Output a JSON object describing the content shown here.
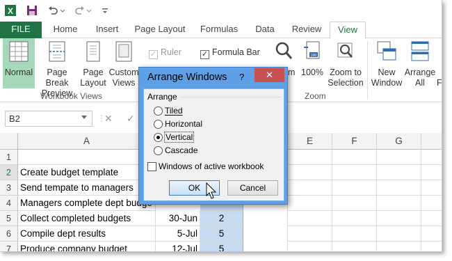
{
  "ribbon_tabs": {
    "file": "FILE",
    "home": "Home",
    "insert": "Insert",
    "page_layout": "Page Layout",
    "formulas": "Formulas",
    "data": "Data",
    "review": "Review",
    "view": "View"
  },
  "ribbon": {
    "normal": "Normal",
    "page_break_1": "Page Break",
    "page_break_2": "Preview",
    "page_layout_1": "Page",
    "page_layout_2": "Layout",
    "custom_1": "Custom",
    "custom_2": "Views",
    "workbook_views": "Workbook Views",
    "ruler": "Ruler",
    "formula_bar": "Formula Bar",
    "zoom_partial": "m",
    "zoom100": "100%",
    "zoom_selection_1": "Zoom to",
    "zoom_selection_2": "Selection",
    "zoom_group": "Zoom",
    "new_window_1": "New",
    "new_window_2": "Window",
    "arrange_all_1": "Arrange",
    "arrange_all_2": "All",
    "overflow": "F"
  },
  "formula_bar": {
    "name_box": "B2",
    "cancel": "✕",
    "enter": "✓"
  },
  "columns": [
    "A",
    "E",
    "F",
    "G"
  ],
  "rows": [
    {
      "num": "1",
      "task": "",
      "date": "",
      "days": ""
    },
    {
      "num": "2",
      "task": "Create budget template",
      "date": "",
      "days": ""
    },
    {
      "num": "3",
      "task": "Send tempate to managers",
      "date": "",
      "days": ""
    },
    {
      "num": "4",
      "task": "Managers complete dept budge",
      "date": "",
      "days": ""
    },
    {
      "num": "5",
      "task": "Collect completed budgets",
      "date": "30-Jun",
      "days": "2"
    },
    {
      "num": "6",
      "task": "Compile dept results",
      "date": "5-Jul",
      "days": "5"
    },
    {
      "num": "7",
      "task": "Produce company budget",
      "date": "12-Jul",
      "days": "5"
    }
  ],
  "dialog": {
    "title": "Arrange Windows",
    "help": "?",
    "close": "✕",
    "group_label": "Arrange",
    "options": [
      "Tiled",
      "Horizontal",
      "Vertical",
      "Cascade"
    ],
    "selected": "Vertical",
    "checkbox_label": "Windows of active workbook",
    "ok": "OK",
    "cancel": "Cancel"
  },
  "colors": {
    "excel_green": "#217346",
    "dialog_blue": "#5f9fe5",
    "close_red": "#c75050",
    "selection_blue": "#c6daf1"
  }
}
